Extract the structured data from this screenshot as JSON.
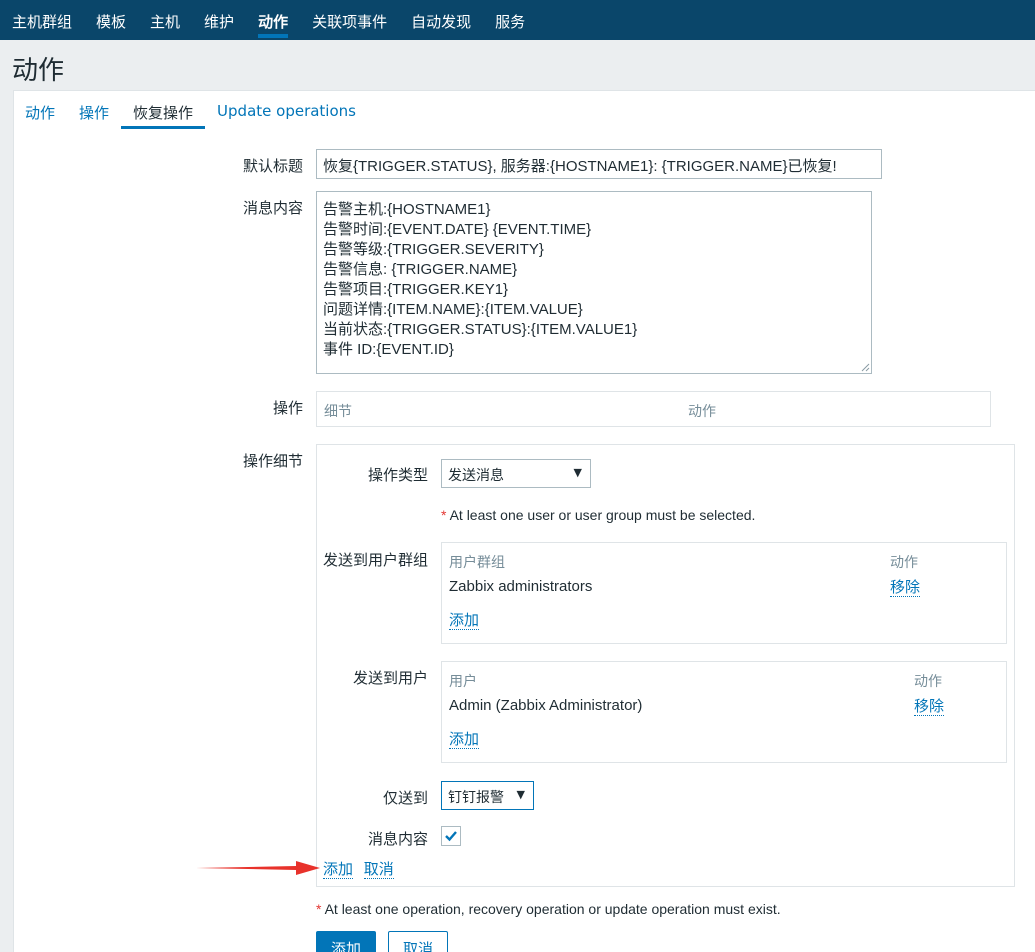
{
  "nav": {
    "items": [
      {
        "label": "主机群组"
      },
      {
        "label": "模板"
      },
      {
        "label": "主机"
      },
      {
        "label": "维护"
      },
      {
        "label": "动作"
      },
      {
        "label": "关联项事件"
      },
      {
        "label": "自动发现"
      },
      {
        "label": "服务"
      }
    ],
    "active_index": 4
  },
  "page": {
    "title": "动作"
  },
  "tabs": [
    {
      "label": "动作"
    },
    {
      "label": "操作"
    },
    {
      "label": "恢复操作"
    },
    {
      "label": "Update operations"
    }
  ],
  "active_tab": 2,
  "form": {
    "subject_label": "默认标题",
    "subject_value": "恢复{TRIGGER.STATUS}, 服务器:{HOSTNAME1}: {TRIGGER.NAME}已恢复!",
    "message_label": "消息内容",
    "message_lines": [
      "告警主机:{HOSTNAME1}",
      "告警时间:{EVENT.DATE} {EVENT.TIME}",
      "告警等级:{TRIGGER.SEVERITY}",
      "告警信息: {TRIGGER.NAME}",
      "告警项目:{TRIGGER.KEY1}",
      "问题详情:{ITEM.NAME}:{ITEM.VALUE}",
      "当前状态:{TRIGGER.STATUS}:{ITEM.VALUE1}",
      "事件 ID:{EVENT.ID}"
    ],
    "operations_label": "操作",
    "operations_headers": {
      "details": "细节",
      "action": "动作"
    },
    "details_label": "操作细节",
    "operation_type_label": "操作类型",
    "operation_type_value": "发送消息",
    "user_required_msg": "At least one user or user group must be selected.",
    "send_groups_label": "发送到用户群组",
    "groups_table": {
      "col_group": "用户群组",
      "col_action": "动作",
      "row_name": "Zabbix administrators",
      "row_action": "移除",
      "add_link": "添加"
    },
    "send_users_label": "发送到用户",
    "users_table": {
      "col_user": "用户",
      "col_action": "动作",
      "row_name": "Admin (Zabbix Administrator)",
      "row_action": "移除",
      "add_link": "添加"
    },
    "send_only_label": "仅送到",
    "send_only_value": "钉钉报警",
    "default_message_label": "消息内容",
    "default_message_checked": true,
    "detail_add_link": "添加",
    "detail_cancel_link": "取消",
    "operation_required_msg": "At least one operation, recovery operation or update operation must exist.",
    "submit_button": "添加",
    "cancel_button": "取消"
  },
  "colors": {
    "nav_bg": "#0a466a",
    "accent": "#0275b8",
    "required": "#e33734",
    "annotation_arrow": "#e8322b"
  }
}
